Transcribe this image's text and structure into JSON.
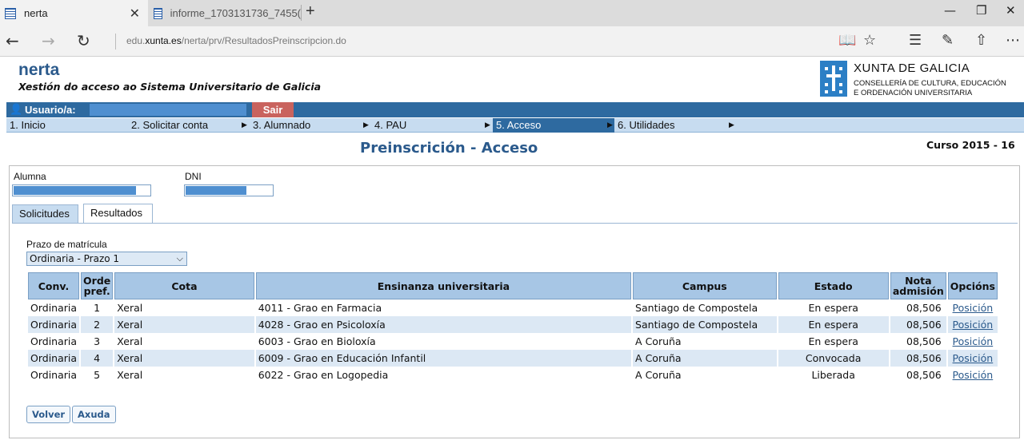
{
  "browser": {
    "tabs": [
      {
        "title": "nerta"
      },
      {
        "title": "informe_1703131736_7455("
      }
    ],
    "url": {
      "prefix": "edu.",
      "domain": "xunta.es",
      "path": "/nerta/prv/ResultadosPreinscripcion.do"
    }
  },
  "header": {
    "app_name": "nerta",
    "app_subtitle": "Xestión do acceso ao Sistema Universitario de Galicia",
    "org_title": "XUNTA DE GALICIA",
    "org_sub_line1": "CONSELLERÍA DE CULTURA, EDUCACIÓN",
    "org_sub_line2": "E ORDENACIÓN UNIVERSITARIA"
  },
  "userbar": {
    "label": "Usuario/a:",
    "logout": "Sair"
  },
  "menu": [
    {
      "label": "1. Inicio"
    },
    {
      "label": "2. Solicitar conta"
    },
    {
      "label": "3. Alumnado"
    },
    {
      "label": "4. PAU"
    },
    {
      "label": "5. Acceso"
    },
    {
      "label": "6. Utilidades"
    }
  ],
  "page": {
    "title": "Preinscrición - Acceso",
    "course": "Curso 2015 - 16"
  },
  "form": {
    "student_label": "Alumna",
    "dni_label": "DNI",
    "tabs": [
      {
        "label": "Solicitudes"
      },
      {
        "label": "Resultados"
      }
    ],
    "prazo_label": "Prazo de matrícula",
    "prazo_value": "Ordinaria - Prazo 1"
  },
  "table": {
    "headers": {
      "conv": "Conv.",
      "orde": "Orde pref.",
      "cota": "Cota",
      "ensinanza": "Ensinanza universitaria",
      "campus": "Campus",
      "estado": "Estado",
      "nota": "Nota admisión",
      "opcions": "Opcións"
    },
    "rows": [
      {
        "conv": "Ordinaria",
        "orde": "1",
        "cota": "Xeral",
        "ensinanza": "4011 - Grao en Farmacia",
        "campus": "Santiago de Compostela",
        "estado": "En espera",
        "nota": "08,506",
        "opcion": "Posición"
      },
      {
        "conv": "Ordinaria",
        "orde": "2",
        "cota": "Xeral",
        "ensinanza": "4028 - Grao en Psicoloxía",
        "campus": "Santiago de Compostela",
        "estado": "En espera",
        "nota": "08,506",
        "opcion": "Posición"
      },
      {
        "conv": "Ordinaria",
        "orde": "3",
        "cota": "Xeral",
        "ensinanza": "6003 - Grao en Bioloxía",
        "campus": "A Coruña",
        "estado": "En espera",
        "nota": "08,506",
        "opcion": "Posición"
      },
      {
        "conv": "Ordinaria",
        "orde": "4",
        "cota": "Xeral",
        "ensinanza": "6009 - Grao en Educación Infantil",
        "campus": "A Coruña",
        "estado": "Convocada",
        "nota": "08,506",
        "opcion": "Posición"
      },
      {
        "conv": "Ordinaria",
        "orde": "5",
        "cota": "Xeral",
        "ensinanza": "6022 - Grao en Logopedia",
        "campus": "A Coruña",
        "estado": "Liberada",
        "nota": "08,506",
        "opcion": "Posición"
      }
    ]
  },
  "buttons": {
    "back": "Volver",
    "help": "Axuda"
  },
  "colors": {
    "header_blue": "#2e6aa0",
    "menu_blue": "#c7dcf0",
    "logout_red": "#c9635e",
    "title_blue": "#2b5a8c"
  }
}
